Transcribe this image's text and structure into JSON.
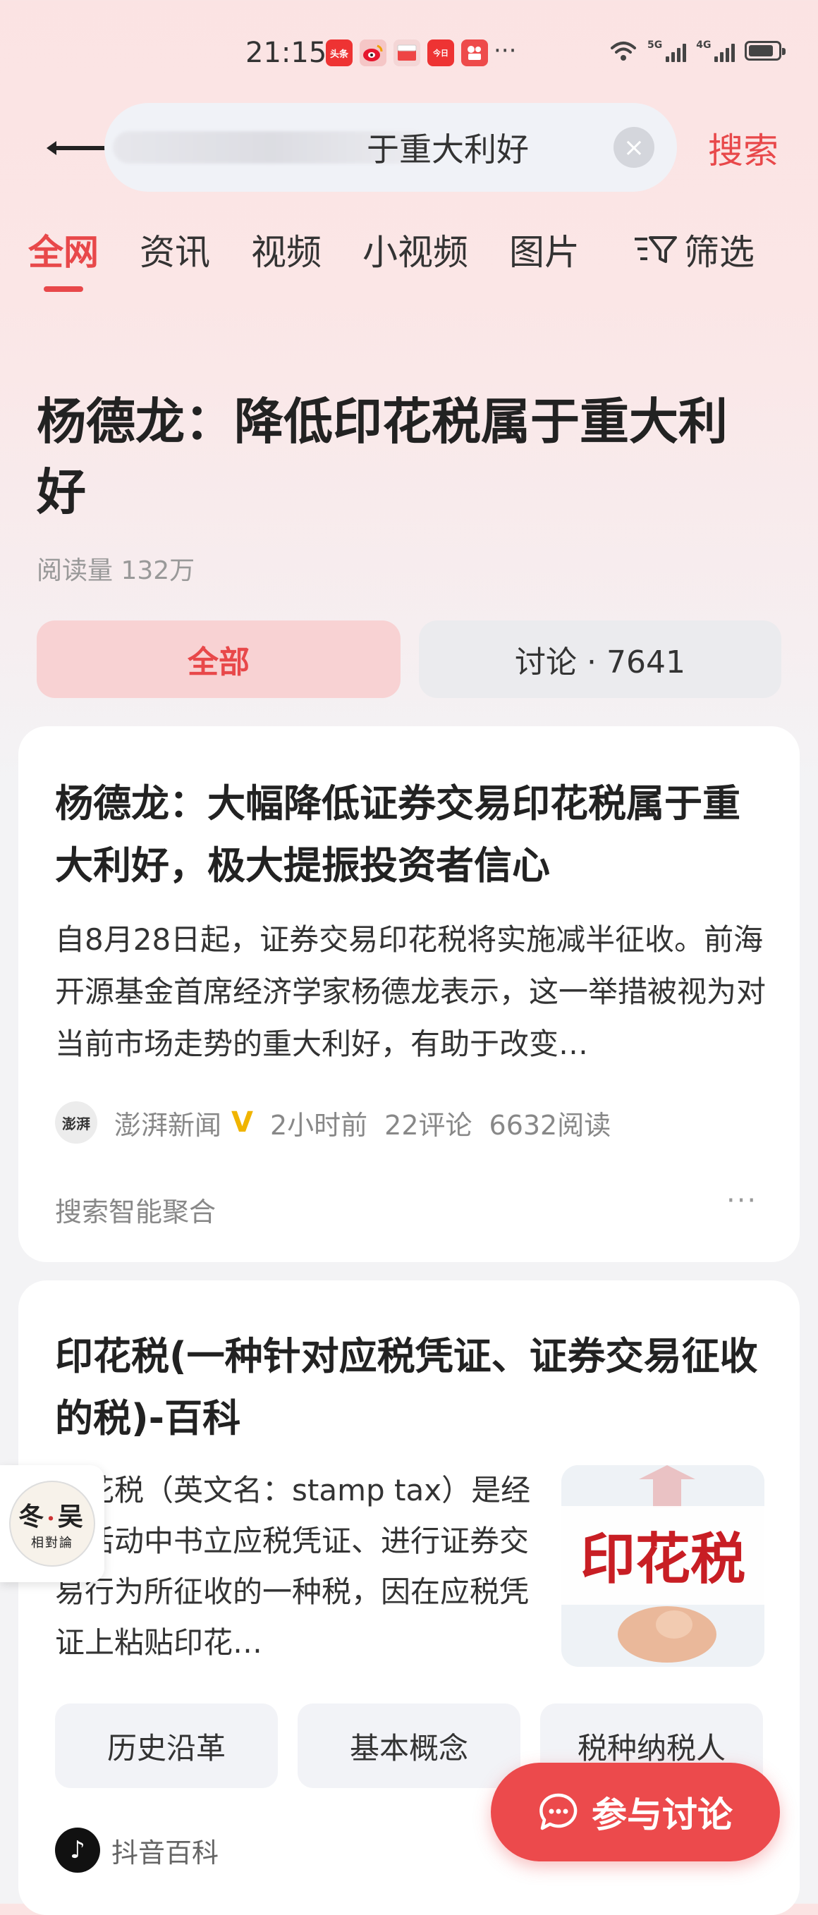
{
  "status_bar": {
    "time": "21:15",
    "more": "···",
    "signal_1_label": "5G",
    "signal_2_label": "4G",
    "battery_level": 0.85
  },
  "search": {
    "query_visible": "于重大利好",
    "button_label": "搜索"
  },
  "tabs": [
    {
      "label": "全网",
      "active": true
    },
    {
      "label": "资讯"
    },
    {
      "label": "视频"
    },
    {
      "label": "小视频"
    },
    {
      "label": "图片"
    }
  ],
  "filter_label": "筛选",
  "topic": {
    "title": "杨德龙：降低印花税属于重大利好",
    "read_count": "阅读量 132万"
  },
  "segments": {
    "all": "全部",
    "discussion": "讨论 · 7641"
  },
  "card1": {
    "title": "杨德龙：大幅降低证券交易印花税属于重大利好，极大提振投资者信心",
    "body": "自8月28日起，证券交易印花税将实施减半征收。前海开源基金首席经济学家杨德龙表示，这一举措被视为对当前市场走势的重大利好，有助于改变…",
    "source_logo": "澎湃",
    "source": "澎湃新闻",
    "verified": "V",
    "time": "2小时前",
    "comments": "22评论",
    "reads": "6632阅读",
    "aggregation": "搜索智能聚合",
    "more": "···"
  },
  "card2": {
    "title": "印花税(一种针对应税凭证、证券交易征收的税)-百科",
    "body": "印花税（英文名：stamp tax）是经济活动中书立应税凭证、进行证券交易行为所征收的一种税，因在应税凭证上粘贴印花…",
    "image_text": "印花税",
    "chips": [
      "历史沿革",
      "基本概念",
      "税种纳税人"
    ],
    "source": "抖音百科"
  },
  "watermark": {
    "line1": "冬",
    "line1b": "吴",
    "line2": "相對論"
  },
  "fab_label": "参与讨论",
  "colors": {
    "accent": "#e8484a",
    "fab": "#ec4a4c",
    "segment_active_bg": "#f8d2d3"
  }
}
